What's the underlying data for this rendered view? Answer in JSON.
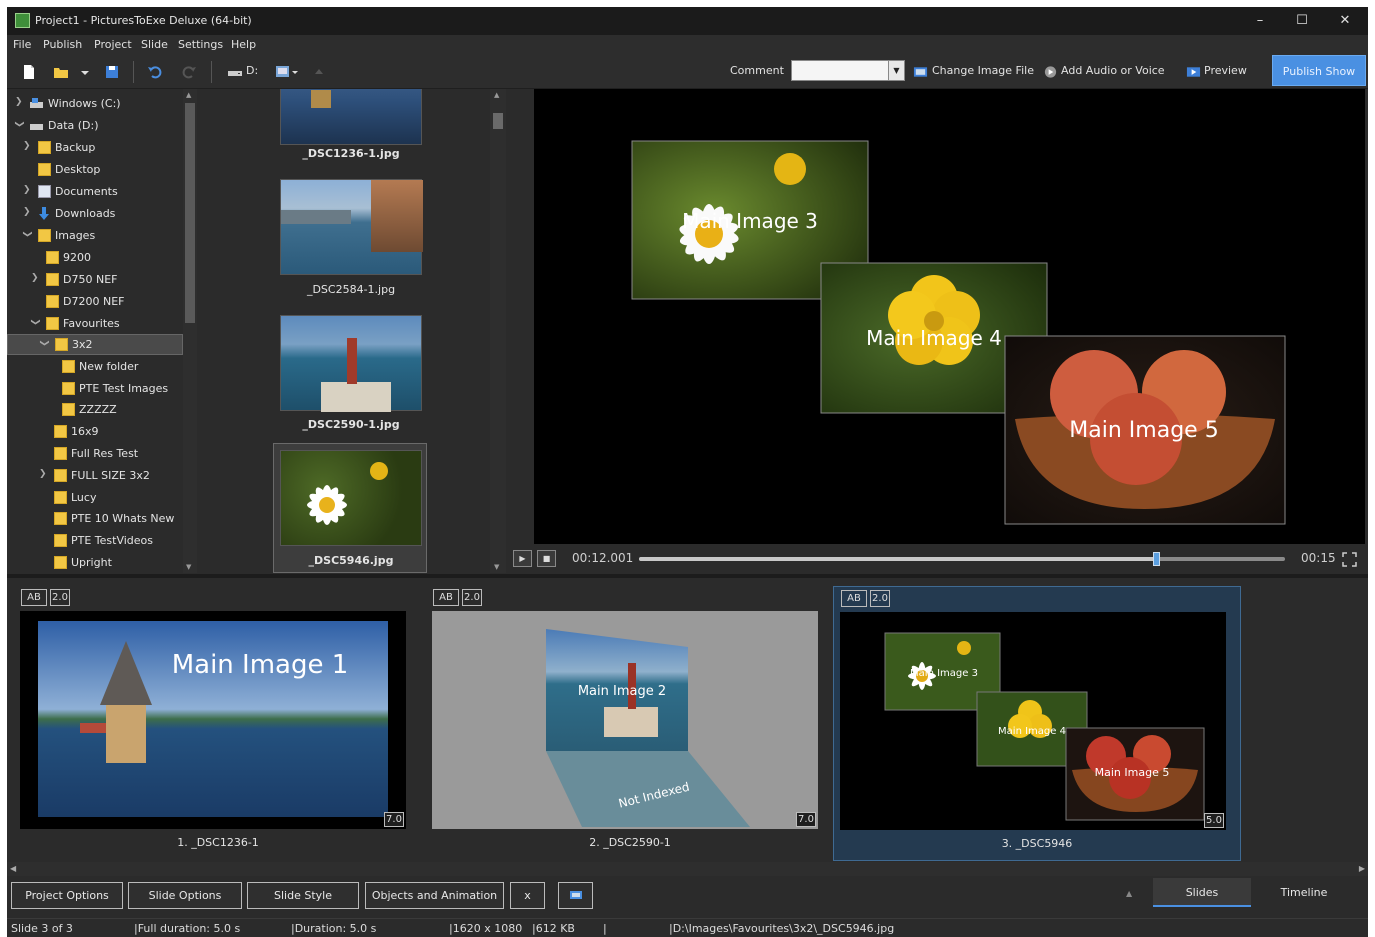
{
  "window": {
    "title": "Project1 - PicturesToExe Deluxe (64-bit)",
    "minimize": "–",
    "maximize": "☐",
    "close": "✕"
  },
  "menu": [
    "File",
    "Publish",
    "Project",
    "Slide",
    "Settings",
    "Help"
  ],
  "toolbar": {
    "drive_label": "D:",
    "comment_label": "Comment",
    "comment_value": "",
    "change_image": "Change Image File",
    "add_audio": "Add Audio or Voice",
    "preview": "Preview",
    "publish": "Publish Show"
  },
  "tree": [
    {
      "label": "Windows (C:)",
      "expanded": false,
      "has_children": true,
      "icon": "drive-icon"
    },
    {
      "label": "Data (D:)",
      "expanded": true,
      "has_children": true,
      "icon": "drive-icon"
    },
    {
      "label": "Backup",
      "expanded": false,
      "has_children": true,
      "icon": "folder-icon"
    },
    {
      "label": "Desktop",
      "expanded": false,
      "has_children": false,
      "icon": "folder-icon"
    },
    {
      "label": "Documents",
      "expanded": false,
      "has_children": true,
      "icon": "documents-icon"
    },
    {
      "label": "Downloads",
      "expanded": false,
      "has_children": true,
      "icon": "downloads-icon"
    },
    {
      "label": "Images",
      "expanded": true,
      "has_children": true,
      "icon": "folder-icon"
    },
    {
      "label": "9200",
      "expanded": false,
      "has_children": false,
      "icon": "folder-icon"
    },
    {
      "label": "D750 NEF",
      "expanded": false,
      "has_children": true,
      "icon": "folder-icon"
    },
    {
      "label": "D7200 NEF",
      "expanded": false,
      "has_children": false,
      "icon": "folder-icon"
    },
    {
      "label": "Favourites",
      "expanded": true,
      "has_children": true,
      "icon": "folder-icon"
    },
    {
      "label": "3x2",
      "expanded": true,
      "has_children": true,
      "icon": "folder-icon",
      "selected": true
    },
    {
      "label": "New folder",
      "expanded": false,
      "has_children": false,
      "icon": "folder-icon"
    },
    {
      "label": "PTE Test Images",
      "expanded": false,
      "has_children": false,
      "icon": "folder-icon"
    },
    {
      "label": "ZZZZZ",
      "expanded": false,
      "has_children": false,
      "icon": "folder-icon"
    },
    {
      "label": "16x9",
      "expanded": false,
      "has_children": false,
      "icon": "folder-icon"
    },
    {
      "label": "Full Res Test",
      "expanded": false,
      "has_children": false,
      "icon": "folder-icon"
    },
    {
      "label": "FULL SIZE 3x2",
      "expanded": false,
      "has_children": true,
      "icon": "folder-icon"
    },
    {
      "label": "Lucy",
      "expanded": false,
      "has_children": false,
      "icon": "folder-icon"
    },
    {
      "label": "PTE 10 Whats New",
      "expanded": false,
      "has_children": false,
      "icon": "folder-icon"
    },
    {
      "label": "PTE TestVideos",
      "expanded": false,
      "has_children": false,
      "icon": "folder-icon"
    },
    {
      "label": "Upright",
      "expanded": false,
      "has_children": false,
      "icon": "folder-icon"
    }
  ],
  "files": [
    {
      "name": "_DSC1236-1.jpg",
      "bold": true
    },
    {
      "name": "_DSC2584-1.jpg",
      "bold": false
    },
    {
      "name": "_DSC2590-1.jpg",
      "bold": true
    },
    {
      "name": "_DSC5946.jpg",
      "bold": true,
      "selected": true
    }
  ],
  "preview": {
    "image3_label": "Main Image 3",
    "image4_label": "Main Image 4",
    "image5_label": "Main Image 5"
  },
  "playbar": {
    "current_time": "00:12.001",
    "total_time": "00:15",
    "progress": 0.8
  },
  "slides": [
    {
      "ab": "AB",
      "speed": "2.0",
      "title": "Main Image 1",
      "duration": "7.0",
      "name": "1. _DSC1236-1",
      "selected": false
    },
    {
      "ab": "AB",
      "speed": "2.0",
      "title": "Main Image 2",
      "extra": "Not Indexed",
      "duration": "7.0",
      "name": "2. _DSC2590-1",
      "selected": false
    },
    {
      "ab": "AB",
      "speed": "2.0",
      "labels": [
        "Main Image 3",
        "Main Image 4",
        "Main Image 5"
      ],
      "duration": "5.0",
      "name": "3. _DSC5946",
      "selected": true
    }
  ],
  "bottom_buttons": [
    "Project Options",
    "Slide Options",
    "Slide Style",
    "Objects and Animation",
    "x"
  ],
  "view_tabs": {
    "slides": "Slides",
    "timeline": "Timeline",
    "active": "Slides"
  },
  "status": {
    "slide": "Slide 3 of 3",
    "full_duration": "|Full duration: 5.0 s",
    "duration": "|Duration: 5.0 s",
    "resolution": "|1620 x 1080",
    "size": "|612 KB",
    "sep": "|",
    "path": "|D:\\Images\\Favourites\\3x2\\_DSC5946.jpg"
  },
  "colors": {
    "accent": "#4a90e2",
    "folder": "#f2c744",
    "selection": "#243a50",
    "background": "#2b2b2b"
  }
}
